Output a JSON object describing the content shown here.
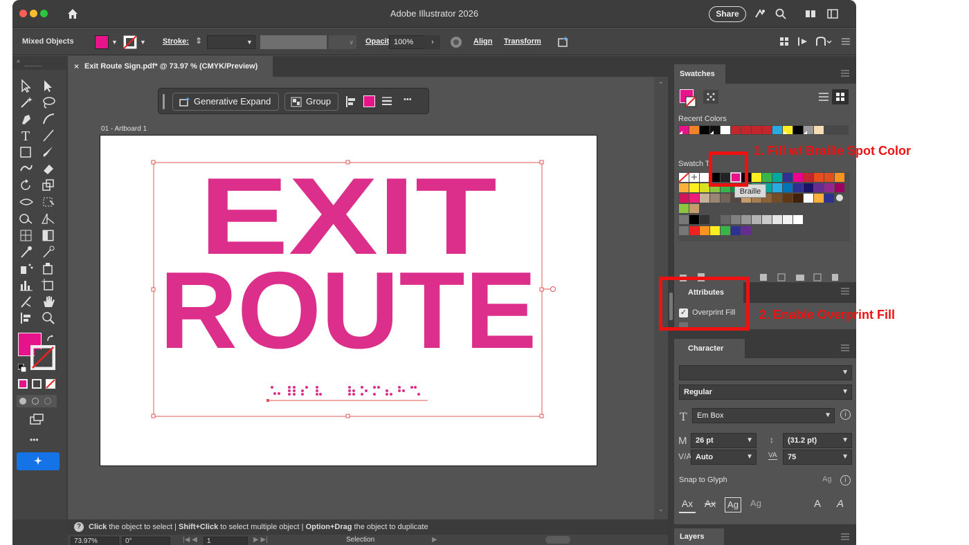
{
  "window": {
    "app_title": "Adobe Illustrator 2026",
    "share_label": "Share"
  },
  "control_bar": {
    "selection_type": "Mixed Objects",
    "stroke_label": "Stroke:",
    "opacity_label": "Opacity:",
    "opacity_value": "100%",
    "align_label": "Align",
    "transform_label": "Transform",
    "brush_definition_hint": "∨"
  },
  "document": {
    "tab_title": "Exit Route Sign.pdf* @ 73.97 % (CMYK/Preview)",
    "artboard_name": "01 - Artboard 1",
    "artwork_line1": "EXIT",
    "artwork_line2": "ROUTE",
    "artwork_color": "#dc2f8b"
  },
  "context_bar": {
    "generative_expand_label": "Generative Expand",
    "group_label": "Group",
    "more_label": "•••"
  },
  "status": {
    "hint_click": "Click",
    "hint_click_text": " the object to select  |  ",
    "hint_shift": "Shift+Click",
    "hint_shift_text": " to select multiple object  |  ",
    "hint_option": "Option+Drag",
    "hint_option_text": " the object to duplicate",
    "zoom": "73.97%",
    "rotation": "0°",
    "artboard_number": "1",
    "tool_name": "Selection"
  },
  "swatches_panel": {
    "title": "Swatches",
    "recent_colors_label": "Recent Colors",
    "swatch_tints_label": "Swatch Ti",
    "tooltip": "Braille"
  },
  "attributes_panel": {
    "title": "Attributes",
    "overprint_fill_label": "Overprint Fill",
    "overprint_fill_checked": true
  },
  "character_panel": {
    "title": "Character",
    "font_family": "",
    "font_style": "Regular",
    "em_box_label": "Em Box",
    "font_size": "26 pt",
    "leading": "(31.2 pt)",
    "kerning": "Auto",
    "tracking": "75",
    "snap_to_glyph_label": "Snap to Glyph"
  },
  "layers_panel": {
    "title": "Layers"
  },
  "annotations": {
    "step1": "1. Fill w/ Braille Spot Color",
    "step2": "2. Enable Overprint Fill",
    "color": "#ee1111"
  },
  "colors": {
    "fill_swatch": "#e6138b",
    "ui_dark": "#3a3a3a",
    "ui_panel": "#535353"
  }
}
